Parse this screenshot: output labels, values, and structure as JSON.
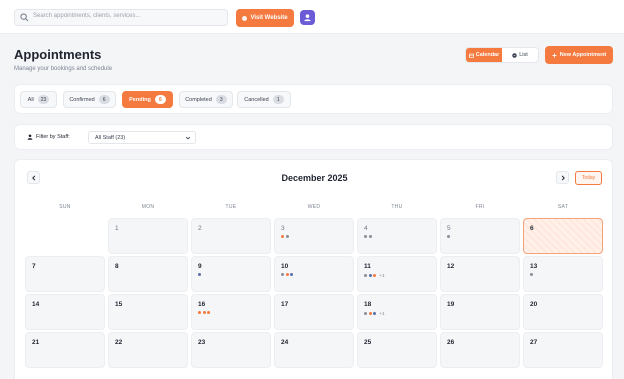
{
  "topbar": {
    "search_placeholder": "Search appointments, clients, services...",
    "visit_label": "Visit Website"
  },
  "header": {
    "title": "Appointments",
    "subtitle": "Manage your bookings and schedule",
    "view_calendar": "Calendar",
    "view_list": "List",
    "new_label": "New Appointment"
  },
  "tabs": [
    {
      "label": "All",
      "count": "23"
    },
    {
      "label": "Confirmed",
      "count": "6"
    },
    {
      "label": "Pending",
      "count": "6"
    },
    {
      "label": "Completed",
      "count": "3"
    },
    {
      "label": "Cancelled",
      "count": "1"
    }
  ],
  "filter": {
    "label": "Filter by Staff:",
    "selected": "All Staff (23)"
  },
  "calendar": {
    "month": "December 2025",
    "today_label": "Today",
    "weekdays": [
      "SUN",
      "MON",
      "TUE",
      "WED",
      "THU",
      "FRI",
      "SAT"
    ],
    "rows": [
      [
        "",
        "1",
        "2",
        "3",
        "4",
        "5",
        "6"
      ],
      [
        "7",
        "8",
        "9",
        "10",
        "11",
        "12",
        "13"
      ],
      [
        "14",
        "15",
        "16",
        "17",
        "18",
        "19",
        "20"
      ],
      [
        "21",
        "22",
        "23",
        "24",
        "25",
        "26",
        "27"
      ]
    ],
    "more": {
      "11": "+1",
      "18": "+1"
    }
  },
  "colors": {
    "accent": "#f47a3f",
    "purple": "#6b5bd6",
    "dot_gray": "#8a8f99",
    "dot_orange": "#f47a3f",
    "dot_blue": "#5a6fa8"
  },
  "icons": [
    "search-icon",
    "globe-icon",
    "user-icon",
    "calendar-icon",
    "list-icon",
    "plus-icon",
    "filter-user-icon",
    "chevron-down-icon",
    "chevron-left-icon",
    "chevron-right-icon"
  ]
}
